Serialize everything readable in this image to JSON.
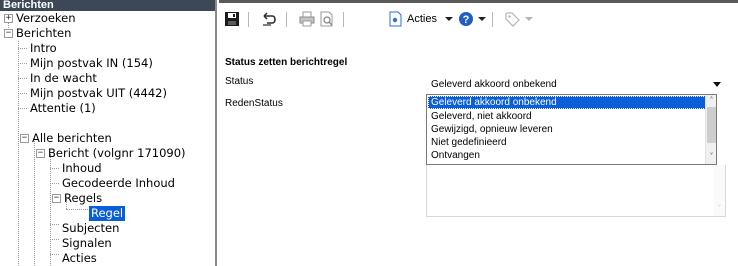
{
  "tree": {
    "header": "Berichten",
    "nodes": [
      {
        "label": "Verzoeken",
        "expander": "+"
      },
      {
        "label": "Berichten",
        "expander": "−"
      },
      {
        "label": "Intro"
      },
      {
        "label": "Mijn postvak IN (154)"
      },
      {
        "label": "In de wacht"
      },
      {
        "label": "Mijn postvak UIT (4442)"
      },
      {
        "label": "Attentie (1)"
      },
      {
        "label": "Alle berichten",
        "expander": "−"
      },
      {
        "label": "Bericht (volgnr 171090)",
        "expander": "−"
      },
      {
        "label": "Inhoud"
      },
      {
        "label": "Gecodeerde Inhoud"
      },
      {
        "label": "Regels",
        "expander": "−"
      },
      {
        "label": "Regel",
        "selected": true
      },
      {
        "label": "Subjecten"
      },
      {
        "label": "Signalen"
      },
      {
        "label": "Acties"
      }
    ]
  },
  "toolbar": {
    "save_icon": "save-icon",
    "undo_icon": "undo-icon",
    "print_icon": "print-icon",
    "preview_icon": "print-preview-icon",
    "acties_label": "Acties",
    "help_icon": "help-icon",
    "tag_icon": "tag-icon"
  },
  "form": {
    "section_title": "Status zetten berichtregel",
    "status_label": "Status",
    "status_value": "Geleverd akkoord onbekend",
    "redenstatus_label": "RedenStatus",
    "options": [
      "Geleverd akkoord onbekend",
      "Geleverd, niet akkoord",
      "Gewijzigd, opnieuw leveren",
      "Niet gedefinieerd",
      "Ontvangen"
    ],
    "selected_option_index": 0
  },
  "colors": {
    "header_bg": "#3d4756",
    "selection": "#0a5ed7",
    "help_blue": "#1f5fbf"
  }
}
